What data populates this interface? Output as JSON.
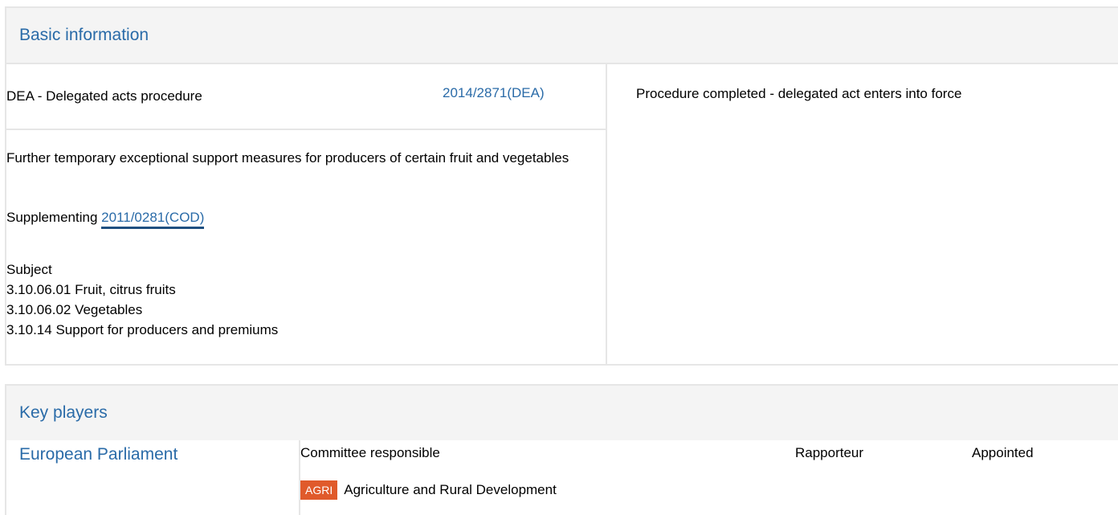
{
  "basic": {
    "heading": "Basic information",
    "procedure_type": "DEA - Delegated acts procedure",
    "procedure_ref": "2014/2871(DEA)",
    "title": "Further temporary exceptional support measures for producers of certain fruit and vegetables",
    "supplementing_label": "Supplementing",
    "supplementing_ref": "2011/0281(COD)",
    "subject_label": "Subject",
    "subjects": [
      "3.10.06.01 Fruit, citrus fruits",
      "3.10.06.02 Vegetables",
      "3.10.14 Support for producers and premiums"
    ],
    "status": "Procedure completed - delegated act enters into force"
  },
  "key_players": {
    "heading": "Key players",
    "institution": "European Parliament",
    "columns": {
      "committee": "Committee responsible",
      "rapporteur": "Rapporteur",
      "appointed": "Appointed"
    },
    "committee": {
      "code": "AGRI",
      "name": "Agriculture and Rural Development"
    }
  },
  "colors": {
    "link": "#2a6ba8",
    "badge": "#e05a2b",
    "header_bg": "#f4f4f4",
    "border": "#e6e6e6"
  }
}
